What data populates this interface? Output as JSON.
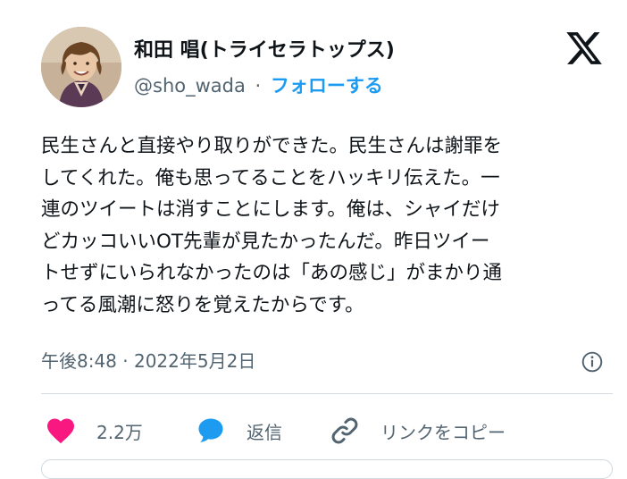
{
  "author": {
    "display_name": "和田 唱(トライセラトップス)",
    "handle": "@sho_wada",
    "separator": "·",
    "follow_label": "フォローする"
  },
  "tweet_lines": [
    "民生さんと直接やり取りができた。民生さんは謝罪を",
    "してくれた。俺も思ってることをハッキリ伝えた。一",
    "連のツイートは消すことにします。俺は、シャイだけ",
    "どカッコいいOT先輩が見たかったんだ。昨日ツイー",
    "トせずにいられなかったのは「あの感じ」がまかり通",
    "ってる風潮に怒りを覚えたからです。"
  ],
  "timestamp": "午後8:48 · 2022年5月2日",
  "actions": {
    "like_count": "2.2万",
    "reply_label": "返信",
    "copy_link_label": "リンクをコピー"
  },
  "colors": {
    "accent": "#1d9bf0",
    "like": "#f91880",
    "text": "#0f1419",
    "muted": "#536471"
  }
}
